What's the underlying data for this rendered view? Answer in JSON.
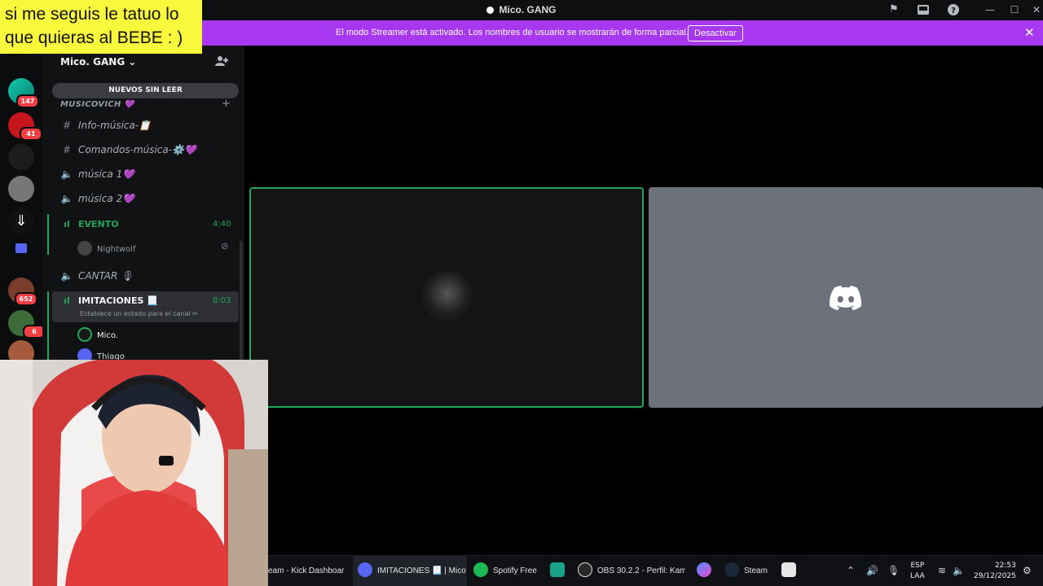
{
  "overlay": {
    "line1": "si me seguis le tatuo lo",
    "line2": "que quieras al BEBE : )"
  },
  "window": {
    "title": "Mico. GANG"
  },
  "banner": {
    "message": "El modo Streamer está activado. Los nombres de usuario se mostrarán de forma parcial.",
    "button_label": "Desactivar",
    "close_label": "✕"
  },
  "server_rail": {
    "badges": [
      "147",
      "41",
      "652",
      "6"
    ]
  },
  "sidebar": {
    "server_name": "Mico. GANG",
    "new_unread": "NUEVOS SIN LEER",
    "category": "MUSICOVICH 💜",
    "channels": [
      {
        "name": "Info-música-📋",
        "type": "text"
      },
      {
        "name": "Comandos-música-⚙️💜",
        "type": "text"
      },
      {
        "name": "música 1💜",
        "type": "voice"
      },
      {
        "name": "música 2💜",
        "type": "voice"
      },
      {
        "name": "EVENTO",
        "type": "voice-active",
        "timer": "4:40"
      },
      {
        "name": "CANTAR 🎙",
        "type": "voice"
      },
      {
        "name": "IMITACIONES 📃",
        "type": "voice-active",
        "timer": "8:03",
        "status_hint": "Establece un estado para el canal ✏"
      }
    ],
    "evento_users": [
      "Nightwolf"
    ],
    "imitaciones_users": [
      "Mico.",
      "Thiago"
    ]
  },
  "taskbar": {
    "apps": [
      {
        "label": "eam - Kick Dashboar"
      },
      {
        "label": "IMITACIONES 📃 | Mico"
      },
      {
        "label": "Spotify Free"
      },
      {
        "label": "OBS 30.2.2 - Perfil: Kam"
      },
      {
        "label": "Steam"
      }
    ],
    "lang_top": "ESP",
    "lang_bottom": "LAA",
    "time": "22:53",
    "date": "29/12/2025"
  },
  "colors": {
    "banner": "#a838f0",
    "voice_green": "#23a55a",
    "overlay_bg": "#f8f93c",
    "discord_blurple": "#5865f2"
  }
}
